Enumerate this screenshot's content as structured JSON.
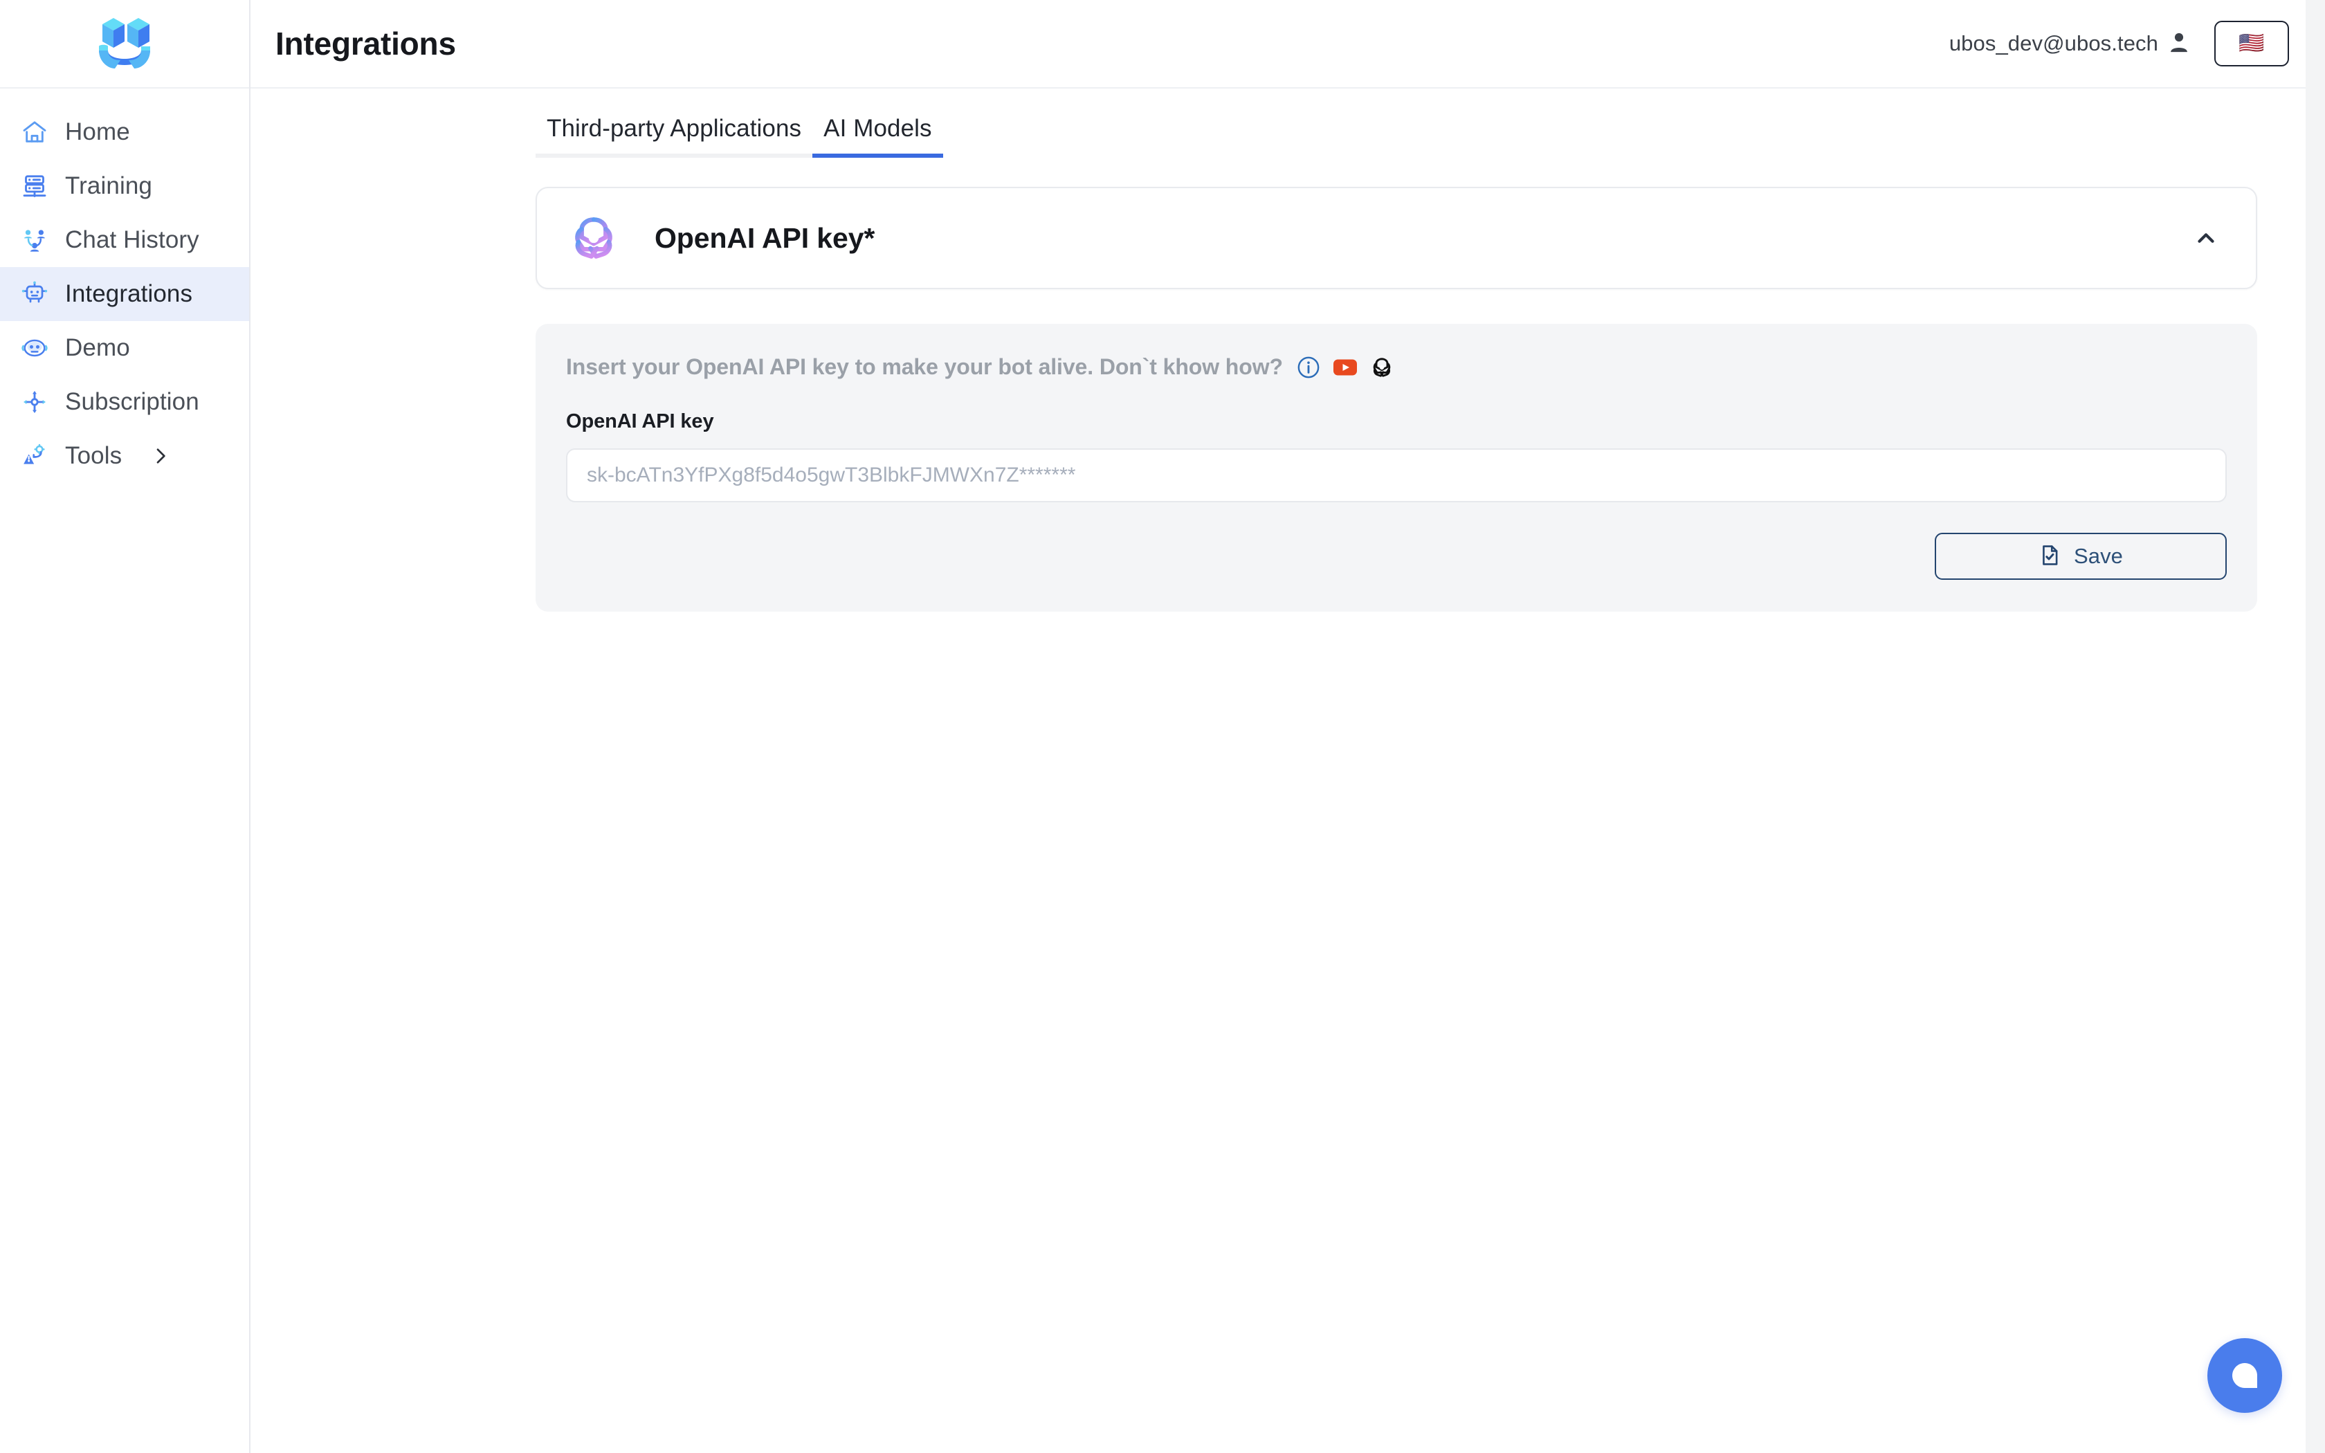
{
  "brand": {
    "logo_name": "ubos-smiley-logo",
    "accent_blue": "#3a6ae0",
    "logo_light_cyan": "#5bd6f5",
    "logo_blue": "#4a8df5",
    "logo_deep_blue": "#3e6fe8"
  },
  "sidebar": {
    "items": [
      {
        "label": "Home",
        "icon": "home-icon",
        "active": false
      },
      {
        "label": "Training",
        "icon": "server-icon",
        "active": false
      },
      {
        "label": "Chat History",
        "icon": "people-chat-icon",
        "active": false
      },
      {
        "label": "Integrations",
        "icon": "robot-icon",
        "active": true
      },
      {
        "label": "Demo",
        "icon": "bot-face-icon",
        "active": false
      },
      {
        "label": "Subscription",
        "icon": "move-arrows-icon",
        "active": false
      },
      {
        "label": "Tools",
        "icon": "tools-gear-icon",
        "active": false,
        "has_chevron": true
      }
    ]
  },
  "header": {
    "title": "Integrations",
    "user_email": "ubos_dev@ubos.tech",
    "user_icon": "user-avatar-icon",
    "language_flag": "🇺🇸",
    "language_flag_name": "us-flag-icon"
  },
  "tabs": [
    {
      "label": "Third-party Applications",
      "active": false
    },
    {
      "label": "AI Models",
      "active": true
    }
  ],
  "card": {
    "title": "OpenAI API key*",
    "logo_name": "openai-logo",
    "collapse_icon": "chevron-up-icon",
    "expanded": true
  },
  "form": {
    "hint_text": "Insert your OpenAI API key to make your bot alive. Don`t khow how?",
    "hint_icons": [
      {
        "name": "info-circle-icon",
        "color": "#2b6cb8"
      },
      {
        "name": "youtube-icon",
        "color": "#e8491f"
      },
      {
        "name": "openai-mono-icon",
        "color": "#111111"
      }
    ],
    "field_label": "OpenAI API key",
    "api_key_value": "",
    "api_key_placeholder": "sk-bcATn3YfPXg8f5d4o5gwT3BlbkFJMWXn7Z*******",
    "save_label": "Save",
    "save_icon": "document-check-icon",
    "save_border_color": "#24456f"
  },
  "chat_widget": {
    "name": "chat-bubble-fab",
    "color": "#4a7dec"
  }
}
